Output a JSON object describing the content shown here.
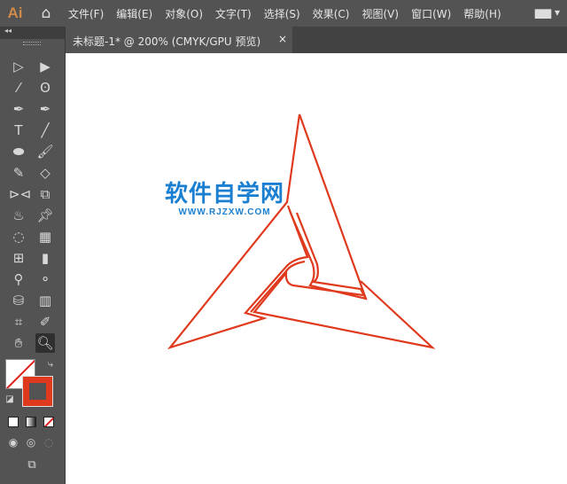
{
  "app": {
    "logo": "Ai",
    "home_icon": "home-icon"
  },
  "menu": [
    "文件(F)",
    "编辑(E)",
    "对象(O)",
    "文字(T)",
    "选择(S)",
    "效果(C)",
    "视图(V)",
    "窗口(W)",
    "帮助(H)"
  ],
  "workspace_icon": "▆▆ ▾",
  "tab": {
    "title": "未标题-1* @ 200% (CMYK/GPU 预览)",
    "close": "×"
  },
  "toolbar": {
    "collapse": "◂◂"
  },
  "watermark": {
    "cn": "软件自学网",
    "en": "WWW.RJZXW.COM"
  },
  "colors": {
    "stroke": "#e03a1e",
    "accent": "#1a7fd0"
  }
}
